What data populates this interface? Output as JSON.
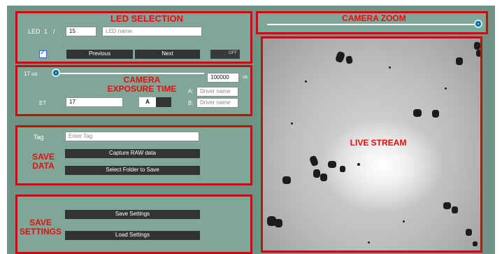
{
  "led_selection": {
    "heading": "LED SELECTION",
    "led_label": "LED",
    "led_index": "1",
    "led_separator": "/",
    "led_count_value": "15",
    "led_name_placeholder": "LED name",
    "previous_label": "Previous",
    "next_label": "Next",
    "toggle_label": "OFF",
    "checkbox_checked": true
  },
  "camera_zoom": {
    "heading": "CAMERA ZOOM",
    "level": 1.0
  },
  "exposure": {
    "heading": "CAMERA\nEXPOSURE TIME",
    "slider_readout": "17 us",
    "max_value": "100000",
    "max_unit": "us",
    "et_label": "ET",
    "et_value": "17",
    "ab_toggle": "A",
    "driver_a_label": "A:",
    "driver_a_placeholder": "Driver name",
    "driver_b_label": "B:",
    "driver_b_placeholder": "Driver name",
    "slider_level": 0.0
  },
  "save_data": {
    "heading": "SAVE\nDATA",
    "tag_label": "Tag",
    "tag_placeholder": "Enter Tag",
    "capture_label": "Capture RAW data",
    "select_folder_label": "Select Folder to Save"
  },
  "save_settings": {
    "heading": "SAVE\nSETTINGS",
    "save_label": "Save Settings",
    "load_label": "Load Settings"
  },
  "live_stream": {
    "heading": "LIVE STREAM"
  },
  "colors": {
    "panel_bg": "#7fa697",
    "annotation_red": "#e80c0c",
    "knob_blue": "#0b6f94",
    "button_dark": "#333333"
  }
}
